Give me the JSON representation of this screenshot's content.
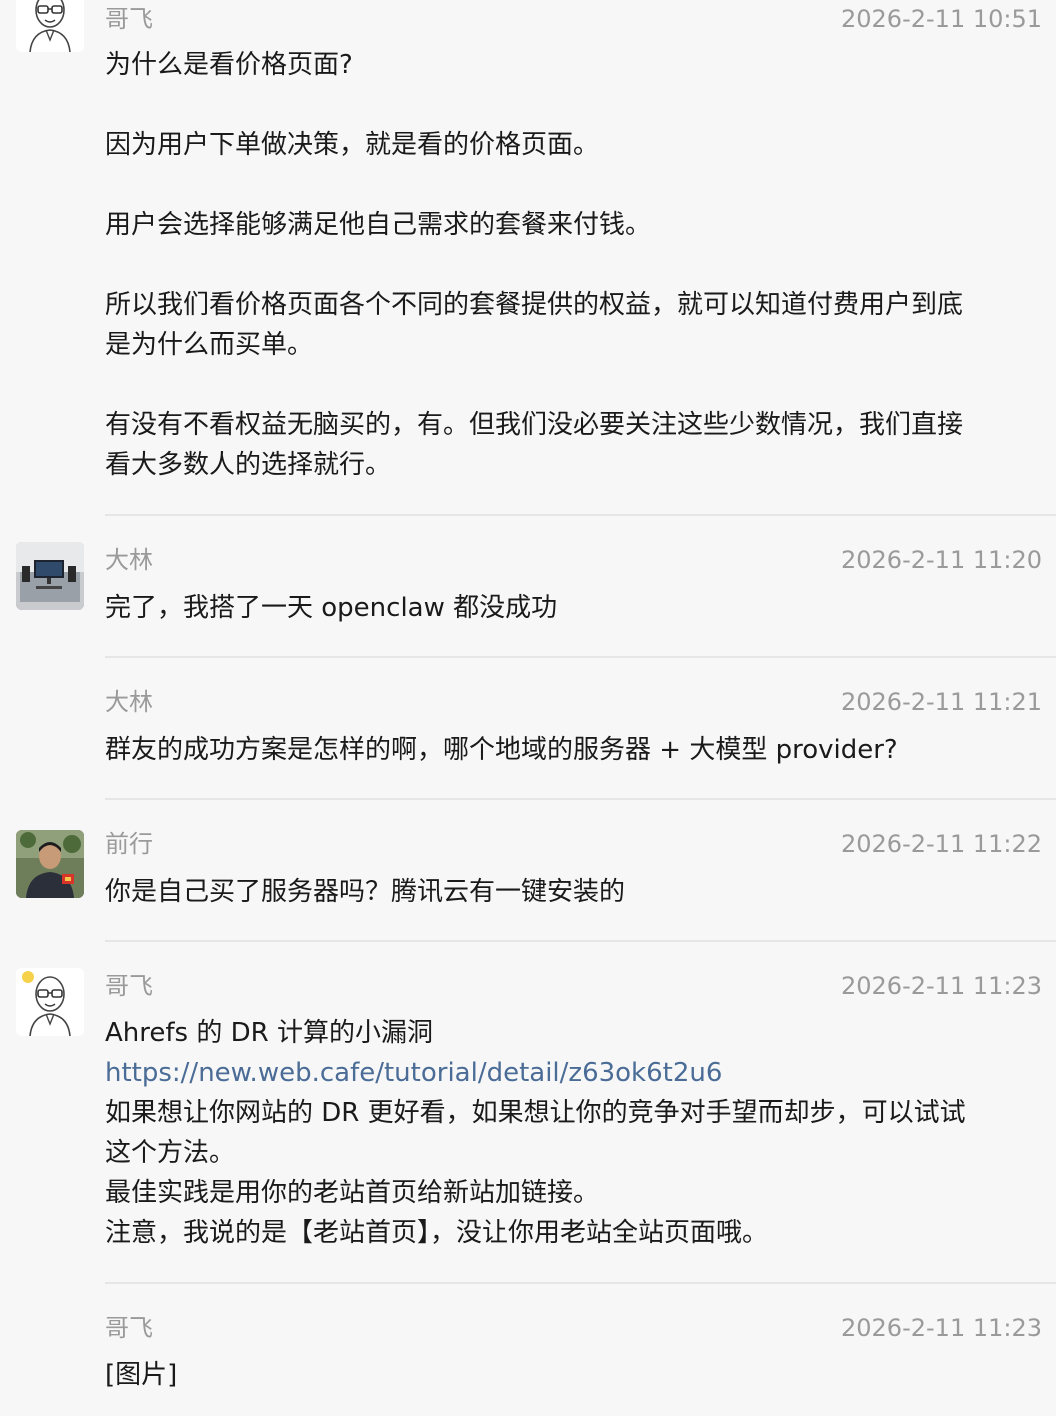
{
  "messages": [
    {
      "sender": "哥飞",
      "time": "2026-2-11 10:51",
      "avatar": "cartoon-glasses-man",
      "lines": [
        "为什么是看价格页面?",
        "因为用户下单做决策，就是看的价格页面。",
        "用户会选择能够满足他自己需求的套餐来付钱。",
        "所以我们看价格页面各个不同的套餐提供的权益，就可以知道付费用户到底",
        "是为什么而买单。",
        "有没有不看权益无脑买的，有。但我们没必要关注这些少数情况，我们直接",
        "看大多数人的选择就行。"
      ]
    },
    {
      "sender": "大林",
      "time": "2026-2-11 11:20",
      "avatar": "desk-monitor-photo",
      "lines": [
        "完了，我搭了一天 openclaw 都没成功"
      ]
    },
    {
      "sender": "大林",
      "time": "2026-2-11 11:21",
      "lines": [
        "群友的成功方案是怎样的啊，哪个地域的服务器 + 大模型 provider?"
      ]
    },
    {
      "sender": "前行",
      "time": "2026-2-11 11:22",
      "avatar": "person-photo",
      "lines": [
        "你是自己买了服务器吗？腾讯云有一键安装的"
      ]
    },
    {
      "sender": "哥飞",
      "time": "2026-2-11 11:23",
      "avatar": "cartoon-glasses-man",
      "lines": [
        "Ahrefs 的 DR 计算的小漏洞",
        "https://new.web.cafe/tutorial/detail/z63ok6t2u6",
        "如果想让你网站的 DR 更好看，如果想让你的竞争对手望而却步，可以试试",
        "这个方法。",
        "最佳实践是用你的老站首页给新站加链接。",
        "注意，我说的是【老站首页】，没让你用老站全站页面哦。"
      ]
    },
    {
      "sender": "哥飞",
      "time": "2026-2-11 11:23",
      "lines": [
        "[图片]"
      ]
    }
  ],
  "colors": {
    "background": "#f7f7f7",
    "meta_text": "#9a9a9a",
    "link": "#4a6c96",
    "divider": "#e6e6e6"
  }
}
